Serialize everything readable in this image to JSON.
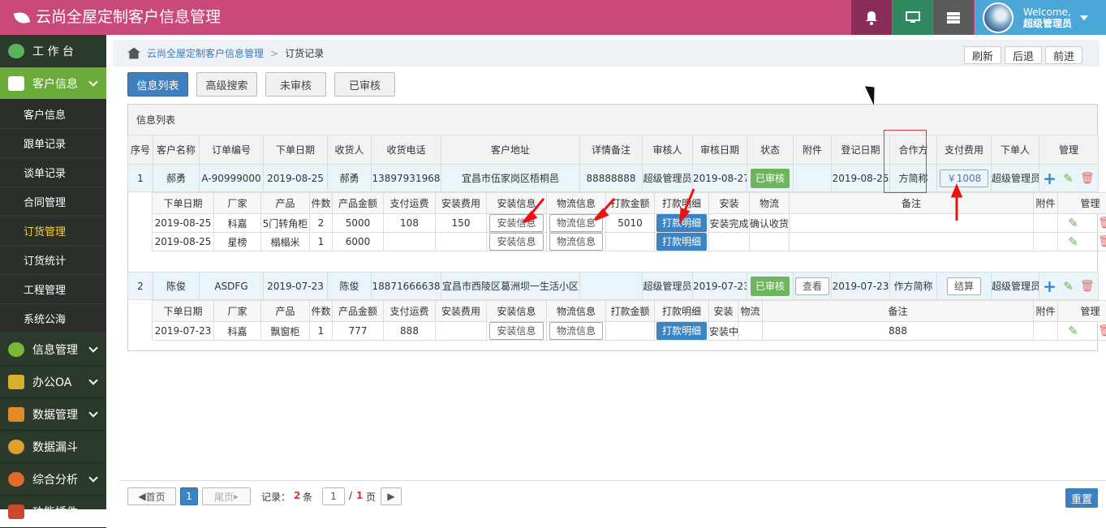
{
  "app": {
    "title": "云尚全屋定制客户信息管理",
    "welcome": "Welcome,",
    "user": "超级管理员"
  },
  "sidebar": {
    "items": [
      {
        "label": "工 作 台"
      },
      {
        "label": "客户信息"
      },
      {
        "label": "客户信息"
      },
      {
        "label": "跟单记录"
      },
      {
        "label": "谈单记录"
      },
      {
        "label": "合同管理"
      },
      {
        "label": "订货管理"
      },
      {
        "label": "订货统计"
      },
      {
        "label": "工程管理"
      },
      {
        "label": "系统公海"
      },
      {
        "label": "信息管理"
      },
      {
        "label": "办公OA"
      },
      {
        "label": "数据管理"
      },
      {
        "label": "数据漏斗"
      },
      {
        "label": "综合分析"
      },
      {
        "label": "功能插件"
      }
    ]
  },
  "breadcrumb": {
    "home": "云尚全屋定制客户信息管理",
    "sep": ">",
    "current": "订货记录"
  },
  "controls": {
    "refresh": "刷新",
    "back": "后退",
    "forward": "前进"
  },
  "tabs": [
    "信息列表",
    "高级搜索",
    "未审核",
    "已审核"
  ],
  "panel_title": "信息列表",
  "headers": [
    "序号",
    "客户名称",
    "订单编号",
    "下单日期",
    "收货人",
    "收货电话",
    "客户地址",
    "详情备注",
    "审核人",
    "审核日期",
    "状态",
    "附件",
    "登记日期",
    "合作方",
    "支付费用",
    "下单人",
    "管理"
  ],
  "sub_headers": [
    "下单日期",
    "厂家",
    "产品",
    "件数",
    "产品金额",
    "支付运费",
    "安装费用",
    "安装信息",
    "物流信息",
    "打款金额",
    "打款明细",
    "安装",
    "物流",
    "备注",
    "附件",
    "管理"
  ],
  "orders": [
    {
      "no": "1",
      "customer": "郝勇",
      "order": "A-90999000",
      "date": "2019-08-25",
      "receiver": "郝勇",
      "phone": "13897931968",
      "address": "宜昌市伍家岗区梧桐邑",
      "note": "88888888",
      "auditor": "超级管理员",
      "audit_date": "2019-08-27",
      "status": "已审核",
      "attach": "",
      "reg_date": "2019-08-25",
      "partner": "方简称",
      "pay": "￥1008",
      "placer": "超级管理员",
      "items": [
        {
          "date": "2019-08-25",
          "factory": "科嘉",
          "product": "5门转角柜",
          "qty": "2",
          "amount": "5000",
          "freight": "108",
          "install_fee": "150",
          "install_btn": "安装信息",
          "logistics_btn": "物流信息",
          "paid": "5010",
          "detail_btn": "打款明细",
          "install": "安装完成",
          "logistics": "确认收货",
          "remark": ""
        },
        {
          "date": "2019-08-25",
          "factory": "星榜",
          "product": "榻榻米",
          "qty": "1",
          "amount": "6000",
          "freight": "",
          "install_fee": "",
          "install_btn": "安装信息",
          "logistics_btn": "物流信息",
          "paid": "",
          "detail_btn": "打款明细",
          "install": "",
          "logistics": "",
          "remark": ""
        }
      ]
    },
    {
      "no": "2",
      "customer": "陈俊",
      "order": "ASDFG",
      "date": "2019-07-23",
      "receiver": "陈俊",
      "phone": "18871666638",
      "address": "宜昌市西陵区葛洲坝一生活小区",
      "note": "",
      "auditor": "超级管理员",
      "audit_date": "2019-07-23",
      "status": "已审核",
      "attach": "查看",
      "reg_date": "2019-07-23",
      "partner": "作方简称",
      "pay": "结算",
      "placer": "超级管理员",
      "items": [
        {
          "date": "2019-07-23",
          "factory": "科嘉",
          "product": "飘窗柜",
          "qty": "1",
          "amount": "777",
          "freight": "888",
          "install_fee": "",
          "install_btn": "安装信息",
          "logistics_btn": "物流信息",
          "paid": "",
          "detail_btn": "打款明细",
          "install": "安装中",
          "logistics": "",
          "remark": "888"
        }
      ]
    }
  ],
  "pager": {
    "first": "首页",
    "page": "1",
    "last": "尾页",
    "records_label": "记录：",
    "records": "2",
    "records_unit": "条",
    "page_input": "1",
    "total_sep": "/",
    "total": "1",
    "total_unit": "页",
    "reset": "重置"
  }
}
